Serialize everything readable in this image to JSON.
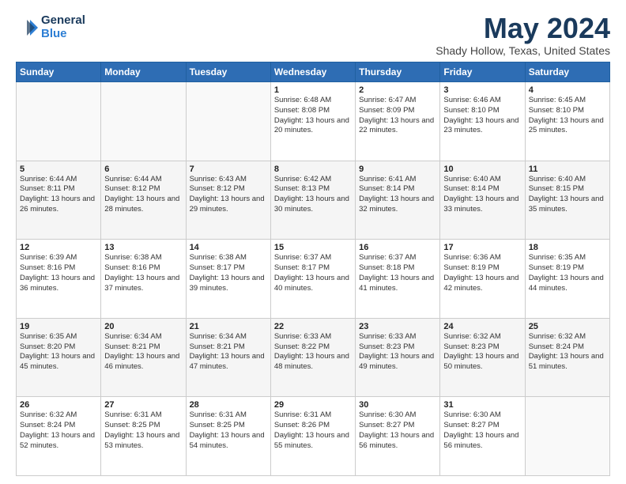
{
  "header": {
    "logo_general": "General",
    "logo_blue": "Blue",
    "month_title": "May 2024",
    "location": "Shady Hollow, Texas, United States"
  },
  "weekdays": [
    "Sunday",
    "Monday",
    "Tuesday",
    "Wednesday",
    "Thursday",
    "Friday",
    "Saturday"
  ],
  "weeks": [
    [
      {
        "day": "",
        "info": ""
      },
      {
        "day": "",
        "info": ""
      },
      {
        "day": "",
        "info": ""
      },
      {
        "day": "1",
        "info": "Sunrise: 6:48 AM\nSunset: 8:08 PM\nDaylight: 13 hours\nand 20 minutes."
      },
      {
        "day": "2",
        "info": "Sunrise: 6:47 AM\nSunset: 8:09 PM\nDaylight: 13 hours\nand 22 minutes."
      },
      {
        "day": "3",
        "info": "Sunrise: 6:46 AM\nSunset: 8:10 PM\nDaylight: 13 hours\nand 23 minutes."
      },
      {
        "day": "4",
        "info": "Sunrise: 6:45 AM\nSunset: 8:10 PM\nDaylight: 13 hours\nand 25 minutes."
      }
    ],
    [
      {
        "day": "5",
        "info": "Sunrise: 6:44 AM\nSunset: 8:11 PM\nDaylight: 13 hours\nand 26 minutes."
      },
      {
        "day": "6",
        "info": "Sunrise: 6:44 AM\nSunset: 8:12 PM\nDaylight: 13 hours\nand 28 minutes."
      },
      {
        "day": "7",
        "info": "Sunrise: 6:43 AM\nSunset: 8:12 PM\nDaylight: 13 hours\nand 29 minutes."
      },
      {
        "day": "8",
        "info": "Sunrise: 6:42 AM\nSunset: 8:13 PM\nDaylight: 13 hours\nand 30 minutes."
      },
      {
        "day": "9",
        "info": "Sunrise: 6:41 AM\nSunset: 8:14 PM\nDaylight: 13 hours\nand 32 minutes."
      },
      {
        "day": "10",
        "info": "Sunrise: 6:40 AM\nSunset: 8:14 PM\nDaylight: 13 hours\nand 33 minutes."
      },
      {
        "day": "11",
        "info": "Sunrise: 6:40 AM\nSunset: 8:15 PM\nDaylight: 13 hours\nand 35 minutes."
      }
    ],
    [
      {
        "day": "12",
        "info": "Sunrise: 6:39 AM\nSunset: 8:16 PM\nDaylight: 13 hours\nand 36 minutes."
      },
      {
        "day": "13",
        "info": "Sunrise: 6:38 AM\nSunset: 8:16 PM\nDaylight: 13 hours\nand 37 minutes."
      },
      {
        "day": "14",
        "info": "Sunrise: 6:38 AM\nSunset: 8:17 PM\nDaylight: 13 hours\nand 39 minutes."
      },
      {
        "day": "15",
        "info": "Sunrise: 6:37 AM\nSunset: 8:17 PM\nDaylight: 13 hours\nand 40 minutes."
      },
      {
        "day": "16",
        "info": "Sunrise: 6:37 AM\nSunset: 8:18 PM\nDaylight: 13 hours\nand 41 minutes."
      },
      {
        "day": "17",
        "info": "Sunrise: 6:36 AM\nSunset: 8:19 PM\nDaylight: 13 hours\nand 42 minutes."
      },
      {
        "day": "18",
        "info": "Sunrise: 6:35 AM\nSunset: 8:19 PM\nDaylight: 13 hours\nand 44 minutes."
      }
    ],
    [
      {
        "day": "19",
        "info": "Sunrise: 6:35 AM\nSunset: 8:20 PM\nDaylight: 13 hours\nand 45 minutes."
      },
      {
        "day": "20",
        "info": "Sunrise: 6:34 AM\nSunset: 8:21 PM\nDaylight: 13 hours\nand 46 minutes."
      },
      {
        "day": "21",
        "info": "Sunrise: 6:34 AM\nSunset: 8:21 PM\nDaylight: 13 hours\nand 47 minutes."
      },
      {
        "day": "22",
        "info": "Sunrise: 6:33 AM\nSunset: 8:22 PM\nDaylight: 13 hours\nand 48 minutes."
      },
      {
        "day": "23",
        "info": "Sunrise: 6:33 AM\nSunset: 8:23 PM\nDaylight: 13 hours\nand 49 minutes."
      },
      {
        "day": "24",
        "info": "Sunrise: 6:32 AM\nSunset: 8:23 PM\nDaylight: 13 hours\nand 50 minutes."
      },
      {
        "day": "25",
        "info": "Sunrise: 6:32 AM\nSunset: 8:24 PM\nDaylight: 13 hours\nand 51 minutes."
      }
    ],
    [
      {
        "day": "26",
        "info": "Sunrise: 6:32 AM\nSunset: 8:24 PM\nDaylight: 13 hours\nand 52 minutes."
      },
      {
        "day": "27",
        "info": "Sunrise: 6:31 AM\nSunset: 8:25 PM\nDaylight: 13 hours\nand 53 minutes."
      },
      {
        "day": "28",
        "info": "Sunrise: 6:31 AM\nSunset: 8:25 PM\nDaylight: 13 hours\nand 54 minutes."
      },
      {
        "day": "29",
        "info": "Sunrise: 6:31 AM\nSunset: 8:26 PM\nDaylight: 13 hours\nand 55 minutes."
      },
      {
        "day": "30",
        "info": "Sunrise: 6:30 AM\nSunset: 8:27 PM\nDaylight: 13 hours\nand 56 minutes."
      },
      {
        "day": "31",
        "info": "Sunrise: 6:30 AM\nSunset: 8:27 PM\nDaylight: 13 hours\nand 56 minutes."
      },
      {
        "day": "",
        "info": ""
      }
    ]
  ]
}
